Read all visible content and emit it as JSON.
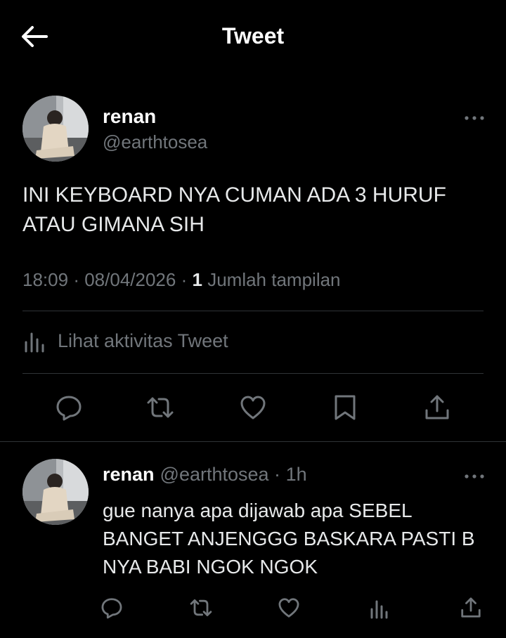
{
  "header": {
    "title": "Tweet"
  },
  "tweet": {
    "author_name": "renan",
    "author_handle": "@earthtosea",
    "text_line1": "INI KEYBOARD NYA CUMAN ADA 3 HURUF",
    "text_line2": "ATAU GIMANA SIH",
    "time": "18:09",
    "date": "08/04/2026",
    "separator": "·",
    "views_count": "1",
    "views_label": "Jumlah tampilan",
    "activity_label": "Lihat aktivitas Tweet"
  },
  "reply": {
    "author_name": "renan",
    "author_handle": "@earthtosea",
    "separator": "·",
    "age": "1h",
    "text_line1": "gue nanya apa dijawab apa SEBEL",
    "text_line2": "BANGET ANJENGGG BASKARA PASTI B",
    "text_line3": "NYA BABI NGOK NGOK"
  },
  "icons": {
    "back": "arrow-left-icon",
    "more": "more-dots-icon",
    "reply": "comment-icon",
    "retweet": "retweet-icon",
    "like": "heart-icon",
    "bookmark": "bookmark-icon",
    "share": "share-icon",
    "analytics": "analytics-icon"
  },
  "colors": {
    "background": "#000000",
    "primary_text": "#e7e9ea",
    "secondary_text": "#71767b",
    "divider": "#2f3336"
  }
}
